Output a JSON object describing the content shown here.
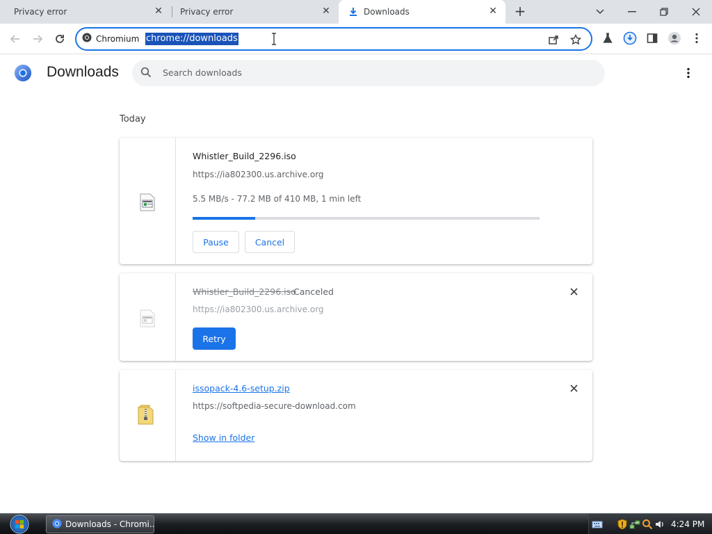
{
  "tabs": [
    {
      "title": "Privacy error",
      "active": false
    },
    {
      "title": "Privacy error",
      "active": false
    },
    {
      "title": "Downloads",
      "active": true
    }
  ],
  "toolbar": {
    "site_chip": "Chromium",
    "url": "chrome://downloads"
  },
  "page": {
    "title": "Downloads",
    "search_placeholder": "Search downloads",
    "section": "Today"
  },
  "downloads": [
    {
      "filename": "Whistler_Build_2296.iso",
      "url": "https://ia802300.us.archive.org",
      "progress_text": "5.5 MB/s - 77.2 MB of 410 MB, 1 min left",
      "progress_fraction": 0.18,
      "pause_label": "Pause",
      "cancel_label": "Cancel"
    },
    {
      "filename": "Whistler_Build_2296.iso",
      "status": "Canceled",
      "url": "https://ia802300.us.archive.org",
      "retry_label": "Retry"
    },
    {
      "filename": "issopack-4.6-setup.zip",
      "url": "https://softpedia-secure-download.com",
      "show_label": "Show in folder"
    }
  ],
  "taskbar": {
    "window_label": "Downloads - Chromi...",
    "clock": "4:24 PM"
  },
  "colors": {
    "accent": "#1a73e8",
    "tabstrip": "#dee1e6"
  }
}
